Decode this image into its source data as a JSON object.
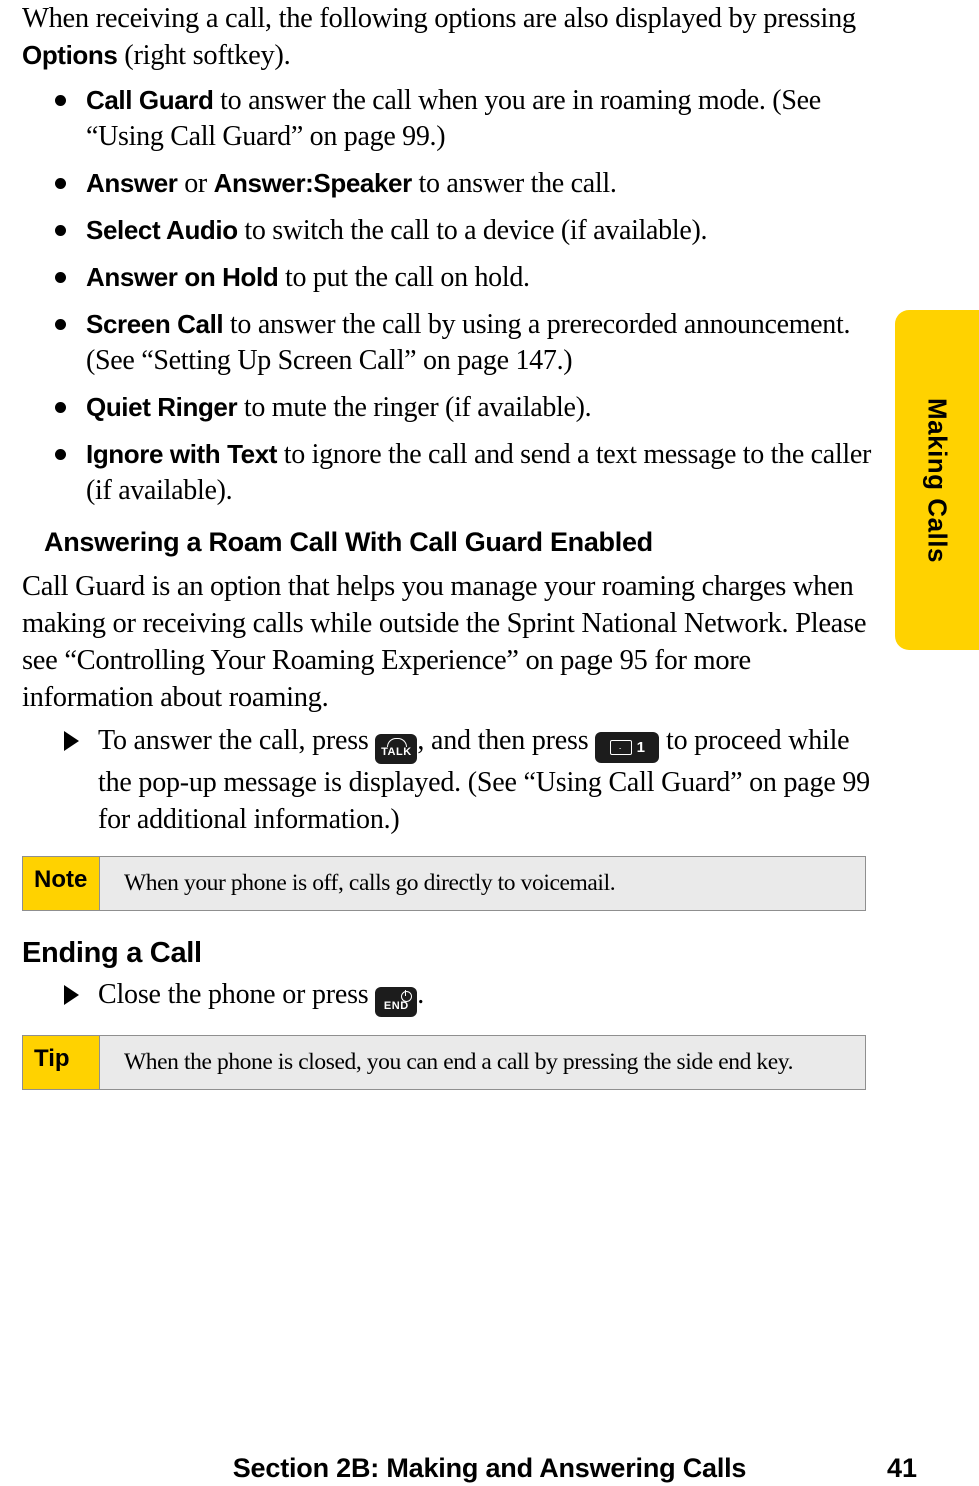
{
  "side_tab": {
    "label": "Making Calls",
    "color": "#ffd200"
  },
  "intro": {
    "before": "When receiving a call, the following options are also displayed by pressing ",
    "bold": "Options",
    "after": " (right softkey)."
  },
  "options": [
    {
      "term": "Call Guard",
      "desc": " to answer the call when you are in roaming mode. (See “Using Call Guard” on page 99.)"
    },
    {
      "term": "Answer",
      "mid": " or ",
      "term2": "Answer:Speaker",
      "desc": " to answer the call."
    },
    {
      "term": "Select Audio",
      "desc": " to switch the call to a device (if available)."
    },
    {
      "term": "Answer on Hold",
      "desc": " to put the call on hold."
    },
    {
      "term": "Screen Call",
      "desc": " to answer the call by using a prerecorded announcement. (See “Setting Up Screen Call” on page 147.)"
    },
    {
      "term": "Quiet Ringer",
      "desc": " to mute the ringer (if available)."
    },
    {
      "term": "Ignore with Text",
      "desc": " to ignore the call and send a text message to the caller (if available)."
    }
  ],
  "subheading": "Answering a Roam Call With Call Guard Enabled",
  "paragraph": "Call Guard is an option that helps you manage your roaming charges when making or receiving calls while outside the Sprint National Network. Please see “Controlling Your Roaming Experience” on page 95 for more information about roaming.",
  "steps": [
    {
      "part1": "To answer the call, press ",
      "key1": "TALK",
      "part2": ", and then press ",
      "key2": "1",
      "part3": " to proceed while the pop-up message is displayed. (See “Using Call Guard” on page 99 for additional information.)"
    }
  ],
  "note": {
    "label": "Note",
    "text": "When your phone is off, calls go directly to voicemail."
  },
  "ending": {
    "heading": "Ending a Call",
    "step_part1": "Close the phone or press ",
    "step_key": "END",
    "step_part2": "."
  },
  "tip": {
    "label": "Tip",
    "text": "When the phone is closed, you can end a call by pressing the side end key."
  },
  "footer": {
    "title": "Section 2B: Making and Answering Calls",
    "page": "41"
  }
}
